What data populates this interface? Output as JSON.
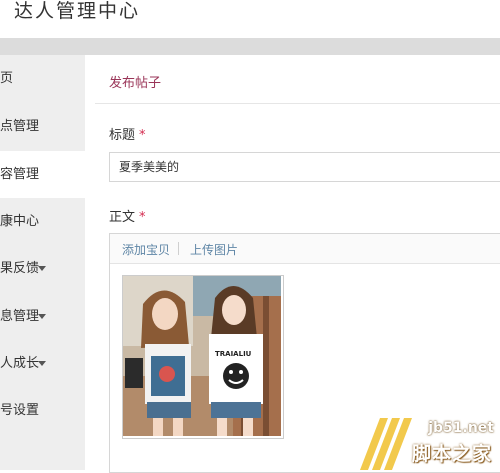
{
  "header": {
    "title": "达人管理中心"
  },
  "sidebar": {
    "items": [
      {
        "label": "页",
        "has_caret": false,
        "active": false
      },
      {
        "label": "点管理",
        "has_caret": false,
        "active": false
      },
      {
        "label": "容管理",
        "has_caret": false,
        "active": true
      },
      {
        "label": "康中心",
        "has_caret": false,
        "active": false
      },
      {
        "label": "果反馈",
        "has_caret": true,
        "active": false
      },
      {
        "label": "息管理",
        "has_caret": true,
        "active": false
      },
      {
        "label": "人成长",
        "has_caret": true,
        "active": false
      },
      {
        "label": "号设置",
        "has_caret": false,
        "active": false
      }
    ]
  },
  "main": {
    "page_title": "发布帖子",
    "title_field": {
      "label": "标题",
      "required_mark": "*",
      "value": "夏季美美的"
    },
    "body_field": {
      "label": "正文",
      "required_mark": "*",
      "toolbar": {
        "add_item": "添加宝贝",
        "upload_image": "上传图片"
      },
      "image_shirt_text": "TRAIALIU"
    }
  },
  "watermark": {
    "url": "jb51.net",
    "text": "脚本之家"
  },
  "colors": {
    "accent": "#9a3558",
    "required": "#d32a4e",
    "link": "#5f86a6",
    "sidebar_bg": "#eeeeee"
  }
}
